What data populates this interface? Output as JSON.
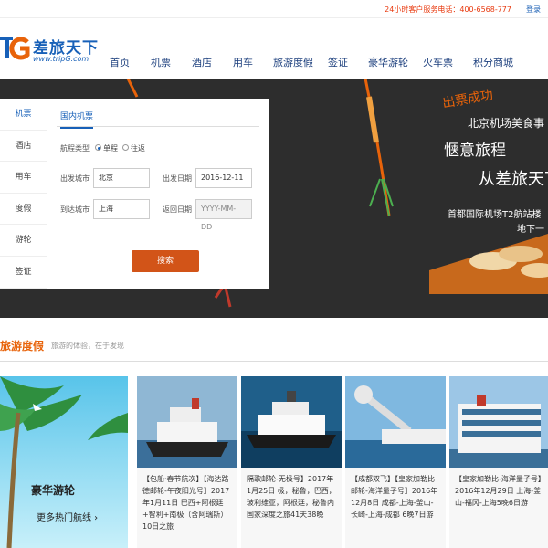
{
  "topbar": {
    "hotline": "24小时客户服务电话：400-6568-777",
    "login": "登录"
  },
  "logo": {
    "mark": "TG",
    "name": "差旅天下",
    "url": "www.tripG.com"
  },
  "nav": {
    "items": [
      "首页",
      "机票",
      "酒店",
      "用车",
      "旅游度假",
      "签证",
      "豪华游轮",
      "火车票",
      "积分商城"
    ]
  },
  "side_menu": {
    "items": [
      "机票",
      "酒店",
      "用车",
      "度假",
      "游轮",
      "签证"
    ]
  },
  "search_panel": {
    "tab": "国内机票",
    "trip_type_label": "航程类型",
    "one_way": "单程",
    "round_trip": "往返",
    "depart_city_label": "出发城市",
    "depart_city": "北京",
    "depart_date_label": "出发日期",
    "depart_date": "2016-12-11",
    "arrive_city_label": "到达城市",
    "arrive_city": "上海",
    "return_date_label": "返回日期",
    "return_date_placeholder": "YYYY-MM-DD",
    "search_button": "搜索"
  },
  "promo": {
    "badge": "出票成功",
    "line1": "北京机场美食事",
    "line2": "惬意旅程",
    "line3": "从差旅天下",
    "line4": "首都国际机场T2航站楼",
    "line5": "地下一"
  },
  "section": {
    "title": "旅游度假",
    "subtitle": "旅游的体验，在于发现"
  },
  "feature": {
    "title": "豪华游轮",
    "more": "更多热门航线 ›"
  },
  "cards": [
    {
      "text": "【包船·春节航次】【海达路德邮轮-午夜阳光号】2017年1月11日 巴西+阿根廷+智利+南极（含阿瑞斯）10日之旅"
    },
    {
      "text": "隔歌邮轮-无极号】2017年1月25日 极，秘鲁，巴西，玻利维亚，阿根廷，秘鲁内国家深度之旅41天38晚"
    },
    {
      "text": "【成都双飞】【皇家加勒比邮轮-海洋量子号】2016年12月8日 成都-上海-釜山-长崎-上海-成都 6晚7日游"
    },
    {
      "text": "【皇家加勒比-海洋量子号】2016年12月29日 上海-釜山-福冈-上海5晚6日游"
    }
  ],
  "colors": {
    "brand_blue": "#1760b8",
    "accent_orange": "#e8630a",
    "search_button": "#d25418",
    "hero_bg": "#2d2d2d"
  }
}
